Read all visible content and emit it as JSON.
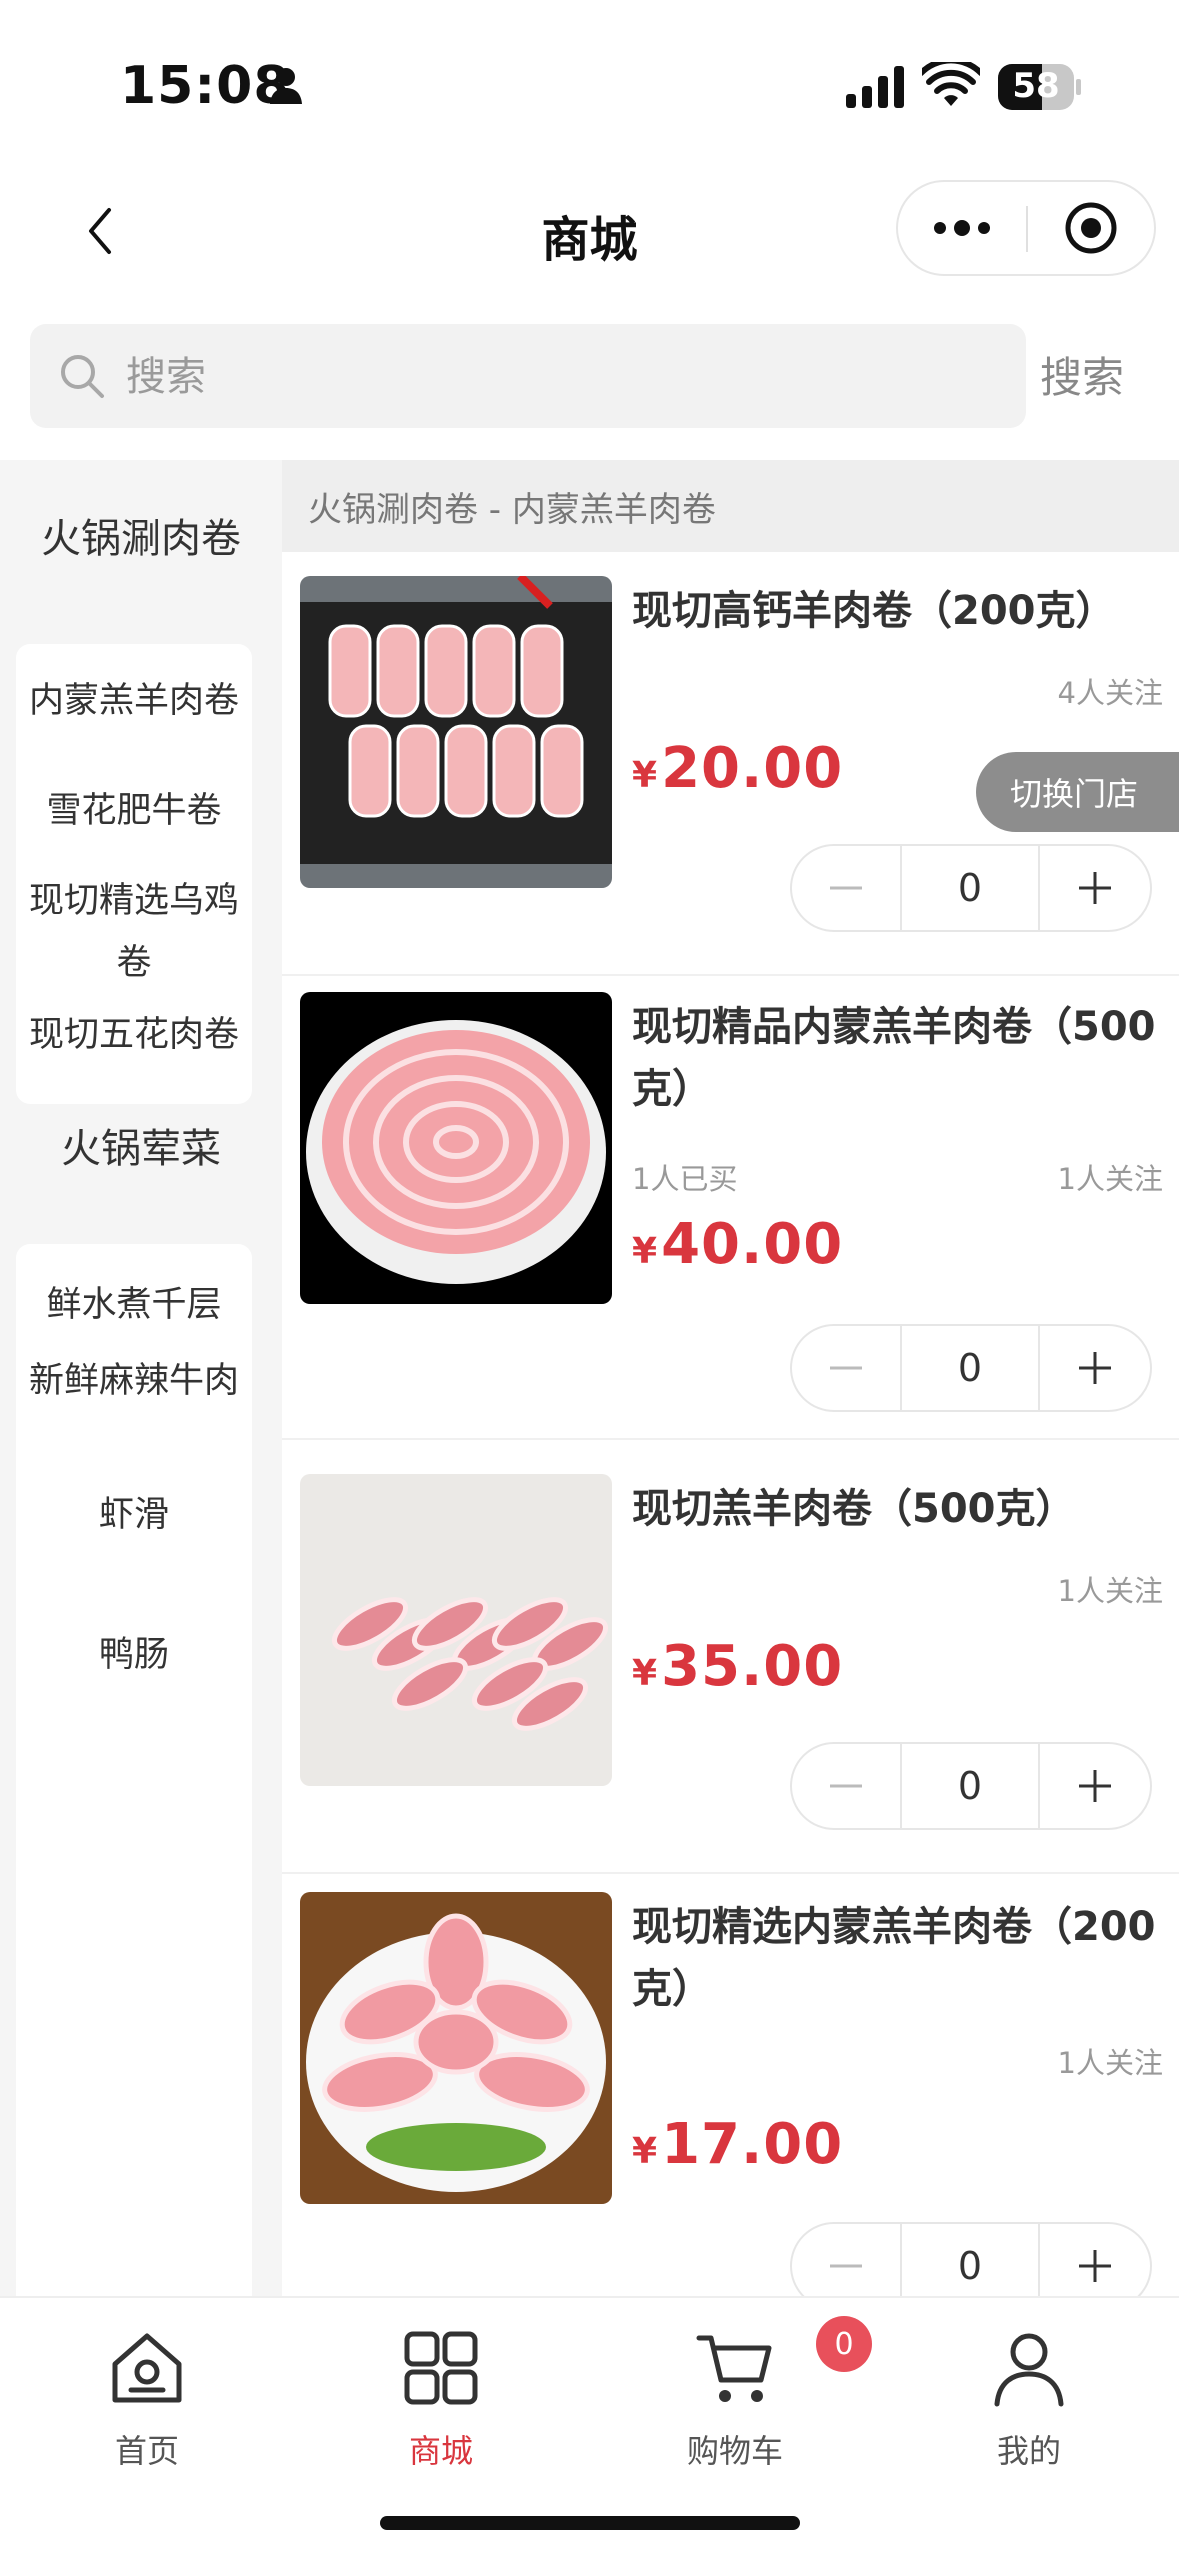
{
  "status_bar": {
    "time": "15:08",
    "battery": "58"
  },
  "nav": {
    "title": "商城"
  },
  "search": {
    "placeholder": "搜索",
    "button_label": "搜索"
  },
  "sidebar": {
    "categories": [
      {
        "title": "火锅涮肉卷",
        "items": [
          "内蒙羔羊肉卷",
          "雪花肥牛卷",
          "现切精选乌鸡卷",
          "现切五花肉卷"
        ]
      },
      {
        "title": "火锅荤菜",
        "items": [
          "鲜水煮千层",
          "新鲜麻辣牛肉",
          "虾滑",
          "鸭肠"
        ]
      }
    ]
  },
  "breadcrumb": "火锅涮肉卷 - 内蒙羔羊肉卷",
  "products": [
    {
      "name": "现切高钙羊肉卷（200克）",
      "sold": "",
      "follow": "4人关注",
      "currency": "¥",
      "price": "20.00",
      "qty": "0"
    },
    {
      "name": "现切精品内蒙羔羊肉卷（500克）",
      "sold": "1人已买",
      "follow": "1人关注",
      "currency": "¥",
      "price": "40.00",
      "qty": "0"
    },
    {
      "name": "现切羔羊肉卷（500克）",
      "sold": "",
      "follow": "1人关注",
      "currency": "¥",
      "price": "35.00",
      "qty": "0"
    },
    {
      "name": "现切精选内蒙羔羊肉卷（200克）",
      "sold": "",
      "follow": "1人关注",
      "currency": "¥",
      "price": "17.00",
      "qty": "0"
    }
  ],
  "switch_store": "切换门店",
  "tabbar": {
    "items": [
      {
        "label": "首页",
        "icon": "home-icon"
      },
      {
        "label": "商城",
        "icon": "grid-icon"
      },
      {
        "label": "购物车",
        "icon": "cart-icon"
      },
      {
        "label": "我的",
        "icon": "user-icon"
      }
    ],
    "active": "商城",
    "cart_count": "0"
  },
  "colors": {
    "accent": "#d9363e",
    "badge": "#e8505b"
  }
}
